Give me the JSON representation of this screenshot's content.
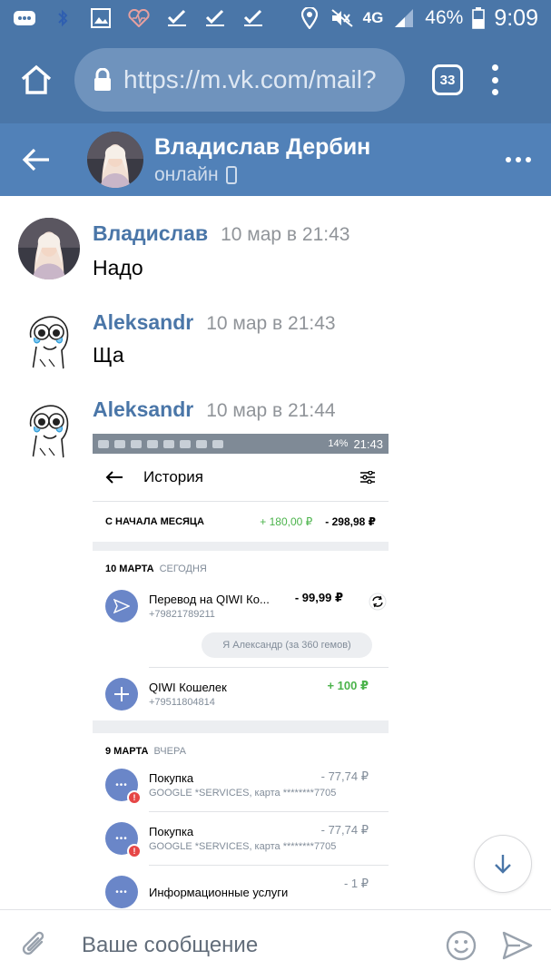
{
  "status_bar": {
    "network": "4G",
    "battery": "46%",
    "time": "9:09"
  },
  "browser": {
    "url": "https://m.vk.com/mail?",
    "tab_count": "33"
  },
  "chat_header": {
    "name": "Владислав Дербин",
    "status": "онлайн"
  },
  "messages": [
    {
      "author": "Владислав",
      "time": "10 мар в 21:43",
      "text": "Надо"
    },
    {
      "author": "Aleksandr",
      "time": "10 мар в 21:43",
      "text": "Ща"
    },
    {
      "author": "Aleksandr",
      "time": "10 мар в 21:44",
      "text": ""
    }
  ],
  "attachment": {
    "status_time": "21:43",
    "status_battery": "14%",
    "title": "История",
    "summary_label": "С НАЧАЛА МЕСЯЦА",
    "summary_income": "+ 180,00 ₽",
    "summary_expense": "- 298,98 ₽",
    "sections": [
      {
        "date": "10 МАРТА",
        "date_note": "СЕГОДНЯ",
        "items": [
          {
            "title": "Перевод на QIWI Ко...",
            "subtitle": "+79821789211",
            "amount": "- 99,99 ₽",
            "comment": "Я Александр (за 360 гемов)"
          },
          {
            "title": "QIWI Кошелек",
            "subtitle": "+79511804814",
            "amount": "+ 100 ₽"
          }
        ]
      },
      {
        "date": "9 МАРТА",
        "date_note": "ВЧЕРА",
        "items": [
          {
            "title": "Покупка",
            "subtitle": "GOOGLE *SERVICES, карта ********7705",
            "amount": "- 77,74 ₽"
          },
          {
            "title": "Покупка",
            "subtitle": "GOOGLE *SERVICES, карта ********7705",
            "amount": "- 77,74 ₽"
          },
          {
            "title": "Информационные услуги",
            "subtitle": "",
            "amount": "- 1 ₽"
          }
        ]
      }
    ]
  },
  "composer": {
    "placeholder": "Ваше сообщение"
  },
  "colors": {
    "browser_bar": "#4a76a8",
    "chat_header": "#5181b8",
    "author_name": "#4a76a8",
    "income_green": "#4bb34b",
    "alert_red": "#e64646"
  }
}
